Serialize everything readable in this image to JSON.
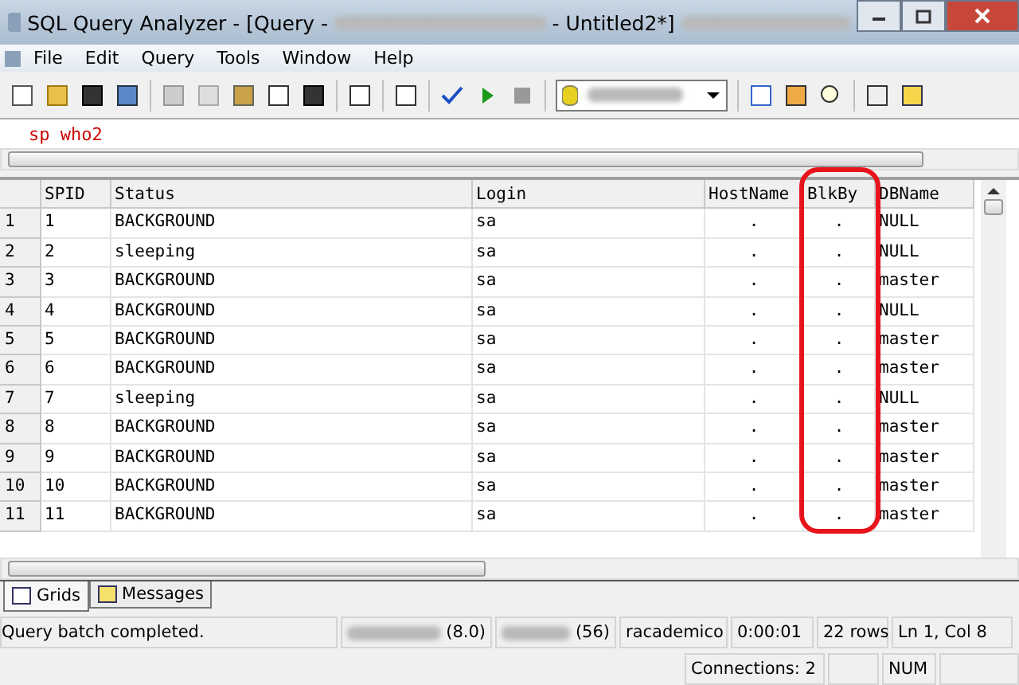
{
  "window": {
    "title_start": "SQL Query Analyzer - [Query -",
    "title_end": "- Untitled2*]"
  },
  "menu": [
    "File",
    "Edit",
    "Query",
    "Tools",
    "Window",
    "Help"
  ],
  "editor": {
    "text": "sp who2"
  },
  "grid": {
    "columns": [
      {
        "circled": false
      },
      {
        "label": "SPID",
        "circled": false
      },
      {
        "label": "Status",
        "circled": false
      },
      {
        "label": "Login",
        "circled": false
      },
      {
        "label": "HostName",
        "circled": false
      },
      {
        "label": "BlkBy",
        "circled": true
      },
      {
        "label": "DBName",
        "circled": false
      }
    ],
    "rows": [
      [
        "1",
        "1",
        "BACKGROUND",
        "sa",
        ".",
        ".",
        "NULL"
      ],
      [
        "2",
        "2",
        "sleeping",
        "sa",
        ".",
        ".",
        "NULL"
      ],
      [
        "3",
        "3",
        "BACKGROUND",
        "sa",
        ".",
        ".",
        "master"
      ],
      [
        "4",
        "4",
        "BACKGROUND",
        "sa",
        ".",
        ".",
        "NULL"
      ],
      [
        "5",
        "5",
        "BACKGROUND",
        "sa",
        ".",
        ".",
        "master"
      ],
      [
        "6",
        "6",
        "BACKGROUND",
        "sa",
        ".",
        ".",
        "master"
      ],
      [
        "7",
        "7",
        "sleeping",
        "sa",
        ".",
        ".",
        "NULL"
      ],
      [
        "8",
        "8",
        "BACKGROUND",
        "sa",
        ".",
        ".",
        "master"
      ],
      [
        "9",
        "9",
        "BACKGROUND",
        "sa",
        ".",
        ".",
        "master"
      ],
      [
        "10",
        "10",
        "BACKGROUND",
        "sa",
        ".",
        ".",
        "master"
      ],
      [
        "11",
        "11",
        "BACKGROUND",
        "sa",
        ".",
        ".",
        "master"
      ]
    ]
  },
  "result_tabs": [
    {
      "label": "Grids",
      "selected": true
    },
    {
      "label": "Messages",
      "selected": false
    }
  ],
  "status_bar": {
    "message": "Query batch completed.",
    "server_version": "(8.0)",
    "user_spid": "(56)",
    "database": "racademico",
    "elapsed": "0:00:01",
    "rows": "22 rows",
    "position": "Ln 1, Col 8"
  },
  "status_bar_2": {
    "connections": "Connections: 2",
    "num": "NUM"
  }
}
